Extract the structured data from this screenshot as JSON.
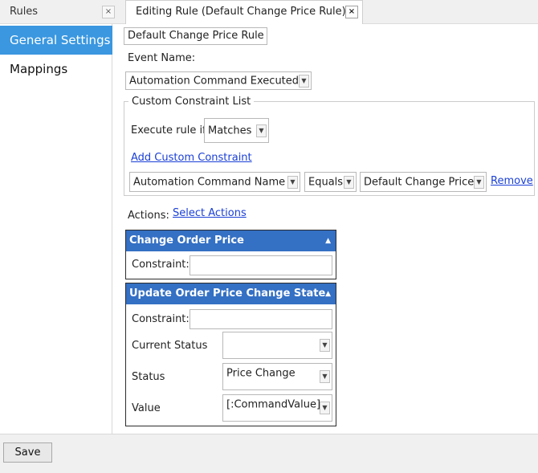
{
  "left_panel": {
    "title": "Rules",
    "close_glyph": "×",
    "nav": [
      {
        "label": "General Settings"
      },
      {
        "label": "Mappings"
      }
    ]
  },
  "tab": {
    "label": "Editing Rule (Default Change Price Rule)",
    "close_glyph": "×"
  },
  "rule": {
    "name_value": "Default Change Price Rule",
    "event_name_label": "Event Name:",
    "event_name_value": "Automation Command Executed"
  },
  "constraints": {
    "group_title": "Custom Constraint List",
    "execute_label": "Execute rule if",
    "execute_value": "Matches",
    "add_link": "Add Custom Constraint",
    "row": {
      "field": "Automation Command Name",
      "operator": "Equals",
      "value": "Default Change Price",
      "remove": "Remove"
    }
  },
  "actions": {
    "label": "Actions:",
    "select_link": "Select Actions",
    "panels": [
      {
        "title": "Change Order Price",
        "constraint_label": "Constraint:",
        "constraint_value": ""
      },
      {
        "title": "Update Order Price Change State",
        "constraint_label": "Constraint:",
        "constraint_value": "",
        "fields": [
          {
            "label": "Current Status",
            "value": ""
          },
          {
            "label": "Status",
            "value": "Price Change"
          },
          {
            "label": "Value",
            "value": "[:CommandValue]"
          }
        ]
      }
    ]
  },
  "footer": {
    "save_label": "Save"
  },
  "colors": {
    "active_nav": "#3a97e0",
    "panel_header": "#3470c4",
    "link": "#1a3fd6"
  }
}
